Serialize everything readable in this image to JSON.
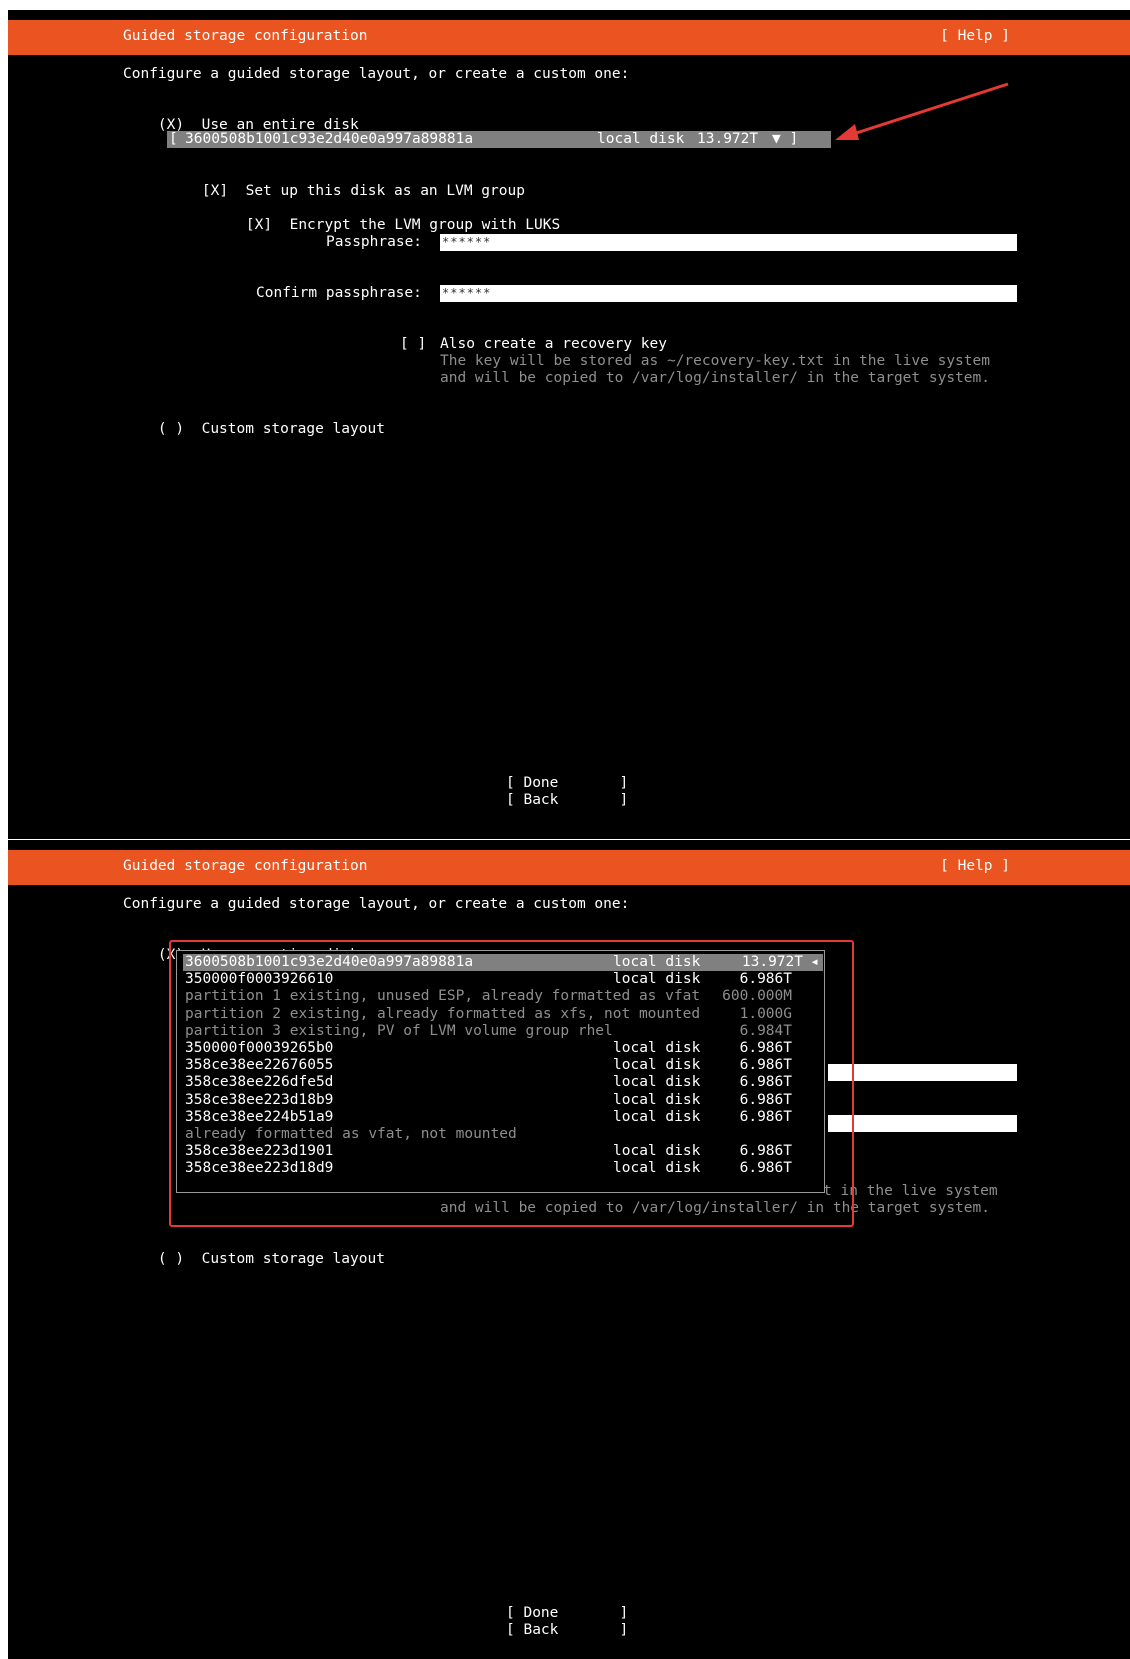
{
  "header": {
    "title": "Guided storage configuration",
    "help": "[ Help ]"
  },
  "intro": "Configure a guided storage layout, or create a custom one:",
  "use_disk": {
    "mark": "(X)",
    "label": "Use an entire disk"
  },
  "selected_disk": {
    "open": "[ ",
    "id": "3600508b1001c93e2d40e0a997a89881a",
    "type": "local disk",
    "size": "13.972T",
    "arrow_closed": "▼ ]",
    "arrow_open": "◂"
  },
  "lvm": {
    "mark": "[X]",
    "label": "Set up this disk as an LVM group"
  },
  "encrypt": {
    "mark": "[X]",
    "label": "Encrypt the LVM group with LUKS"
  },
  "passphrase": {
    "label": "Passphrase:",
    "value": "******"
  },
  "confirm": {
    "label": "Confirm passphrase:",
    "value": "******"
  },
  "recovery": {
    "mark": "[ ]",
    "label": "Also create a recovery key",
    "line1": "The key will be stored as ~/recovery-key.txt in the live system",
    "line2": "and will be copied to /var/log/installer/ in the target system.",
    "partial_line1": "t in the live system",
    "partial_line2": "in the target system."
  },
  "custom": {
    "mark": "( )",
    "label": "Custom storage layout"
  },
  "buttons": {
    "done": "[ Done       ]",
    "back": "[ Back       ]"
  },
  "disk_list": [
    {
      "name": "3600508b1001c93e2d40e0a997a89881a",
      "type": "local disk",
      "size": "13.972T",
      "dim": false,
      "selected": true
    },
    {
      "name": "350000f0003926610",
      "type": "local disk",
      "size": "6.986T",
      "dim": false,
      "selected": false
    },
    {
      "name": "partition 1 existing, unused ESP, already formatted as vfat",
      "type": "",
      "size": "600.000M",
      "dim": true,
      "selected": false
    },
    {
      "name": "partition 2 existing, already formatted as xfs, not mounted",
      "type": "",
      "size": "1.000G",
      "dim": true,
      "selected": false
    },
    {
      "name": "partition 3 existing, PV of LVM volume group rhel",
      "type": "",
      "size": "6.984T",
      "dim": true,
      "selected": false
    },
    {
      "name": "350000f00039265b0",
      "type": "local disk",
      "size": "6.986T",
      "dim": false,
      "selected": false
    },
    {
      "name": "358ce38ee22676055",
      "type": "local disk",
      "size": "6.986T",
      "dim": false,
      "selected": false
    },
    {
      "name": "358ce38ee226dfe5d",
      "type": "local disk",
      "size": "6.986T",
      "dim": false,
      "selected": false
    },
    {
      "name": "358ce38ee223d18b9",
      "type": "local disk",
      "size": "6.986T",
      "dim": false,
      "selected": false
    },
    {
      "name": "358ce38ee224b51a9",
      "type": "local disk",
      "size": "6.986T",
      "dim": false,
      "selected": false
    },
    {
      "name": "already formatted as vfat, not mounted",
      "type": "",
      "size": "",
      "dim": true,
      "selected": false
    },
    {
      "name": "358ce38ee223d1901",
      "type": "local disk",
      "size": "6.986T",
      "dim": false,
      "selected": false
    },
    {
      "name": "358ce38ee223d18d9",
      "type": "local disk",
      "size": "6.986T",
      "dim": false,
      "selected": false
    }
  ],
  "colors": {
    "header_bg": "#e95420",
    "annotation": "#e53935",
    "selection_bg": "#808080"
  }
}
